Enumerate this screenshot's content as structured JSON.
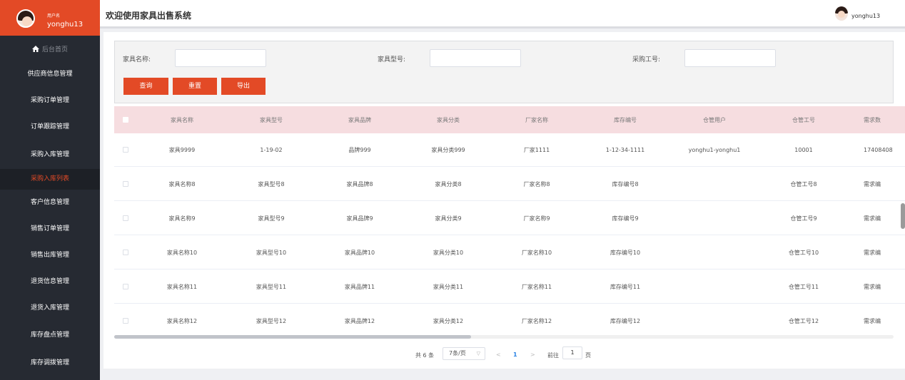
{
  "sidebar": {
    "user_role": "用户名",
    "user_name": "yonghu13",
    "items": [
      {
        "label": "后台首页"
      },
      {
        "label": "供应商信息管理"
      },
      {
        "label": "采购订单管理"
      },
      {
        "label": "订单跟踪管理"
      },
      {
        "label": "采购入库管理"
      },
      {
        "label": "采购入库列表"
      },
      {
        "label": "客户信息管理"
      },
      {
        "label": "销售订单管理"
      },
      {
        "label": "销售出库管理"
      },
      {
        "label": "退货信息管理"
      },
      {
        "label": "退货入库管理"
      },
      {
        "label": "库存盘点管理"
      },
      {
        "label": "库存调拨管理"
      }
    ]
  },
  "header": {
    "title": "欢迎使用家具出售系统",
    "user_name": "yonghu13"
  },
  "search": {
    "name_label": "家具名称:",
    "model_label": "家具型号:",
    "staff_label": "采购工号:",
    "name_value": "",
    "model_value": "",
    "staff_value": "",
    "query_label": "查询",
    "reset_label": "重置",
    "export_label": "导出"
  },
  "table": {
    "columns": [
      "家具名称",
      "家具型号",
      "家具品牌",
      "家具分类",
      "厂家名称",
      "库存编号",
      "仓管用户",
      "仓管工号",
      "需求数"
    ],
    "rows": [
      [
        "家具9999",
        "1-19-02",
        "品牌999",
        "家具分类999",
        "厂家1111",
        "1-12-34-1111",
        "yonghu1-yonghu1",
        "10001",
        "17408408"
      ],
      [
        "家具名称8",
        "家具型号8",
        "家具品牌8",
        "家具分类8",
        "厂家名称8",
        "库存编号8",
        "",
        "仓管工号8",
        "需求编"
      ],
      [
        "家具名称9",
        "家具型号9",
        "家具品牌9",
        "家具分类9",
        "厂家名称9",
        "库存编号9",
        "",
        "仓管工号9",
        "需求编"
      ],
      [
        "家具名称10",
        "家具型号10",
        "家具品牌10",
        "家具分类10",
        "厂家名称10",
        "库存编号10",
        "",
        "仓管工号10",
        "需求编"
      ],
      [
        "家具名称11",
        "家具型号11",
        "家具品牌11",
        "家具分类11",
        "厂家名称11",
        "库存编号11",
        "",
        "仓管工号11",
        "需求编"
      ],
      [
        "家具名称12",
        "家具型号12",
        "家具品牌12",
        "家具分类12",
        "厂家名称12",
        "库存编号12",
        "",
        "仓管工号12",
        "需求编"
      ]
    ]
  },
  "pagination": {
    "total": "共 6 条",
    "page_size": "7条/页",
    "prev": "<",
    "current_page": "1",
    "next": ">",
    "goto_label": "前往",
    "goto_value": "1",
    "page_suffix": "页"
  },
  "colors": {
    "accent": "#e34a26",
    "sidebar_bg": "#262a32",
    "table_header_bg": "#f6dde0"
  }
}
